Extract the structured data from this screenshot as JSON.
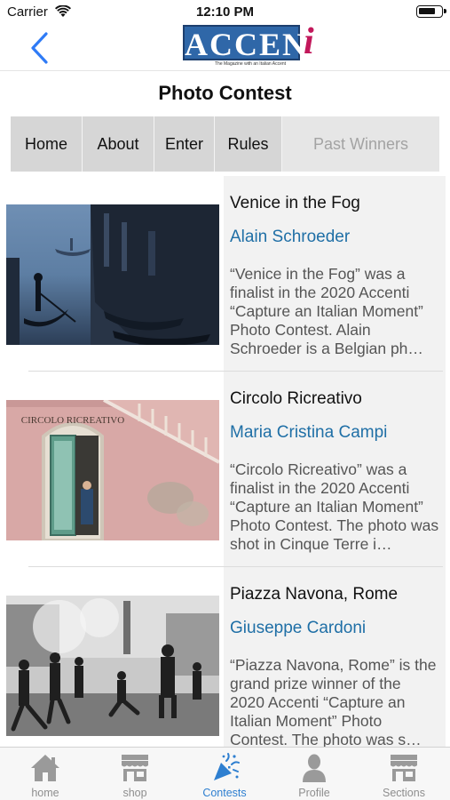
{
  "status_bar": {
    "carrier": "Carrier",
    "time": "12:10 PM",
    "battery_level": 0.8
  },
  "nav": {
    "back_icon": "chevron-left-icon",
    "logo": {
      "word": "ACCENT",
      "letter_i": "i",
      "tagline": "The Magazine with an Italian Accent",
      "box_color": "#2f67a8",
      "accent_color": "#c2185b"
    }
  },
  "page_title": "Photo Contest",
  "tabs": [
    {
      "label": "Home",
      "selected": false
    },
    {
      "label": "About",
      "selected": false
    },
    {
      "label": "Enter",
      "selected": false
    },
    {
      "label": "Rules",
      "selected": false
    },
    {
      "label": "Past Winners",
      "selected": true
    }
  ],
  "entries": [
    {
      "title": "Venice in the Fog",
      "author": "Alain Schroeder",
      "description": "“Venice in the Fog” was a finalist in the 2020 Accenti “Capture an Italian Moment” Photo Contest. Alain Schroeder is a Belgian ph…"
    },
    {
      "title": "Circolo Ricreativo",
      "author": "Maria Cristina Campi",
      "description": "“Circolo Ricreativo” was a finalist in the 2020 Accenti “Capture an Italian Moment” Photo Contest. The photo was shot in Cinque Terre i…",
      "sign_text": "CIRCOLO RICREATIVO"
    },
    {
      "title": "Piazza Navona, Rome",
      "author": "Giuseppe Cardoni",
      "description": "“Piazza Navona, Rome” is the grand prize winner of the 2020 Accenti “Capture an Italian Moment” Photo Contest. The photo was s…"
    }
  ],
  "tab_bar": [
    {
      "label": "home",
      "icon": "house-icon",
      "active": false
    },
    {
      "label": "shop",
      "icon": "storefront-icon",
      "active": false
    },
    {
      "label": "Contests",
      "icon": "party-popper-icon",
      "active": true
    },
    {
      "label": "Profile",
      "icon": "person-icon",
      "active": false
    },
    {
      "label": "Sections",
      "icon": "storefront-icon",
      "active": false
    }
  ],
  "colors": {
    "link_blue": "#1f6fa6",
    "tab_active_blue": "#2e7fd0",
    "tab_inactive_gray": "#8e8e8e",
    "ios_blue": "#2f7bf6"
  }
}
